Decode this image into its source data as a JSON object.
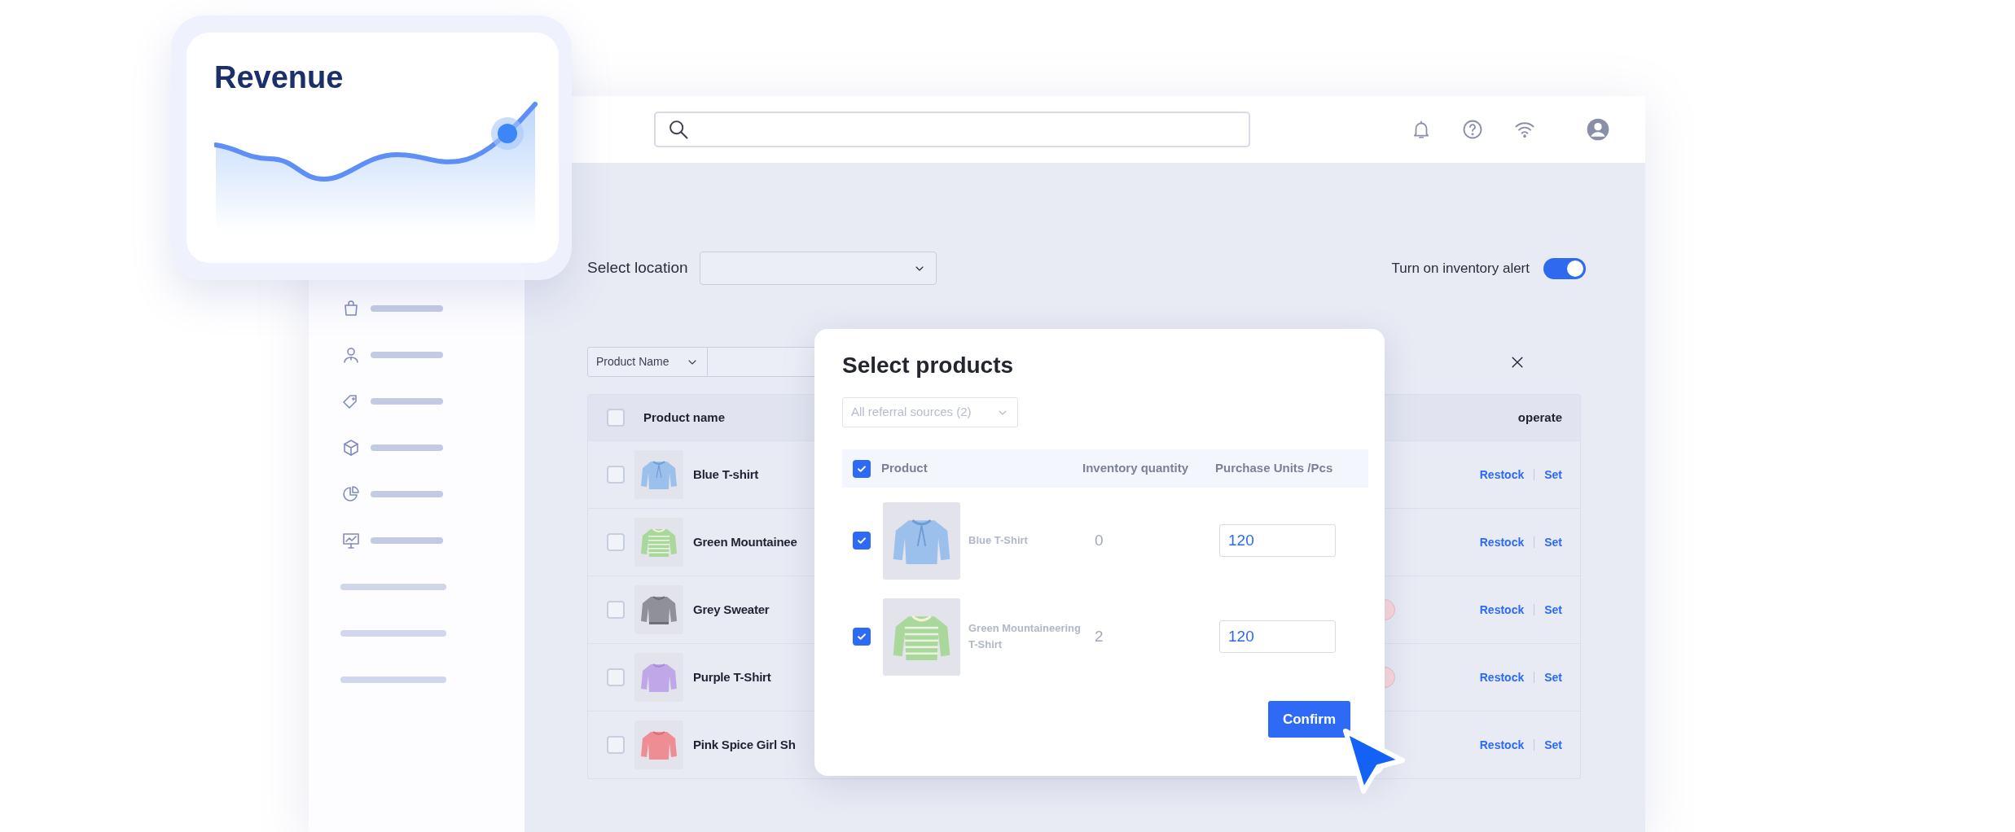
{
  "revenue_card": {
    "title": "Revenue"
  },
  "sidebar": {
    "items": [
      {
        "kind": "icon"
      },
      {
        "kind": "icon"
      },
      {
        "kind": "icon"
      },
      {
        "kind": "icon"
      },
      {
        "kind": "icon"
      },
      {
        "kind": "icon"
      },
      {
        "kind": "bar"
      },
      {
        "kind": "bar"
      },
      {
        "kind": "bar"
      }
    ]
  },
  "location": {
    "label": "Select location"
  },
  "inventory_alert": {
    "label": "Turn on inventory alert",
    "on": true
  },
  "filter": {
    "field": "Product Name"
  },
  "table": {
    "all_checked": false,
    "columns": [
      "Product name",
      "operate"
    ],
    "rows": [
      {
        "name": "Blue T-shirt",
        "checked": false,
        "alert": false,
        "actions": [
          "Restock",
          "Set"
        ]
      },
      {
        "name": "Green Mountainee",
        "checked": false,
        "alert": false,
        "actions": [
          "Restock",
          "Set"
        ]
      },
      {
        "name": "Grey Sweater",
        "checked": false,
        "alert": true,
        "actions": [
          "Restock",
          "Set"
        ]
      },
      {
        "name": "Purple T-Shirt",
        "checked": false,
        "alert": true,
        "actions": [
          "Restock",
          "Set"
        ]
      },
      {
        "name": "Pink Spice Girl Sh",
        "checked": false,
        "alert": false,
        "actions": [
          "Restock",
          "Set"
        ]
      }
    ]
  },
  "modal": {
    "title": "Select products",
    "source_filter": "All referral sources (2)",
    "all_checked": true,
    "columns": [
      "Product",
      "Inventory quantity",
      "Purchase Units /Pcs"
    ],
    "rows": [
      {
        "name": "Blue T-Shirt",
        "checked": true,
        "inventory": "0",
        "units": "120"
      },
      {
        "name": "Green Mountaineering T-Shirt",
        "checked": true,
        "inventory": "2",
        "units": "120"
      }
    ],
    "confirm": "Confirm"
  }
}
